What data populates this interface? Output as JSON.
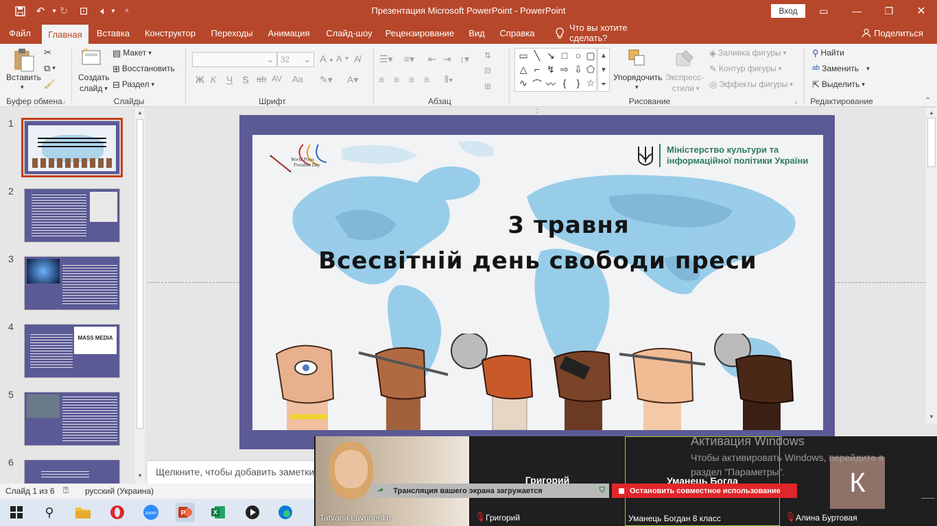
{
  "titlebar": {
    "title": "Презентация Microsoft PowerPoint  -  PowerPoint",
    "signin": "Вход",
    "qat_icons": [
      "save-icon",
      "undo-icon",
      "redo-icon",
      "present-icon",
      "audio-icon",
      "qat-dropdown-icon"
    ]
  },
  "tabs": [
    "Файл",
    "Главная",
    "Вставка",
    "Конструктор",
    "Переходы",
    "Анимация",
    "Слайд-шоу",
    "Рецензирование",
    "Вид",
    "Справка"
  ],
  "tellme": "Что вы хотите сделать?",
  "share": "Поделиться",
  "ribbon": {
    "groups": {
      "clipboard": "Буфер обмена",
      "slides": "Слайды",
      "font": "Шрифт",
      "paragraph": "Абзац",
      "drawing": "Рисование",
      "editing": "Редактирование"
    },
    "paste": "Вставить",
    "new_slide_1": "Создать",
    "new_slide_2": "слайд",
    "layout": "Макет",
    "reset": "Восстановить",
    "section": "Раздел",
    "font_size": "32",
    "font_buttons": [
      "Ж",
      "К",
      "Ч",
      "S",
      "ab",
      "AV",
      "Aa"
    ],
    "arrange": "Упорядочить",
    "quick_styles_1": "Экспресс-",
    "quick_styles_2": "стили",
    "shape_fill": "Заливка фигуры",
    "shape_outline": "Контур фигуры",
    "shape_effects": "Эффекты фигуры",
    "find": "Найти",
    "replace": "Заменить",
    "select": "Выделить"
  },
  "thumbnails": [
    {
      "num": "1"
    },
    {
      "num": "2"
    },
    {
      "num": "3"
    },
    {
      "num": "4",
      "badge": "MASS MEDIA"
    },
    {
      "num": "5"
    },
    {
      "num": "6"
    }
  ],
  "slide": {
    "line1": "3 травня",
    "line2": "Всесвітній день свободи преси",
    "ministry_1": "Міністерство культури та",
    "ministry_2": "інформаційної політики України",
    "logo_text_1": "World Press",
    "logo_text_2": "Freedom Day"
  },
  "notes_placeholder": "Щелкните, чтобы добавить заметки",
  "status": {
    "slide": "Слайд 1 из 6",
    "language": "русский (Украина)"
  },
  "zoom": {
    "participants": [
      {
        "name": "Tatyana Lavrinenko"
      },
      {
        "name": "Григорий",
        "top_name": "Григорий"
      },
      {
        "name": "Уманець Богдан 8 класс",
        "top_name": "Уманець Богда"
      },
      {
        "name": "Алина Буртовая",
        "avatar": "К"
      }
    ],
    "loading": "Трансляция вашего экрана загружается",
    "stop_share": "Остановить совместное использование",
    "activation_title": "Активация Windows",
    "activation_text_1": "Чтобы активировать Windows, перейдите в",
    "activation_text_2": "раздел \"Параметры\"."
  },
  "colors": {
    "accent": "#b7472a",
    "slide_frame": "#5b5a96",
    "ministry_green": "#2e7d5b",
    "stop_red": "#e0262a"
  }
}
